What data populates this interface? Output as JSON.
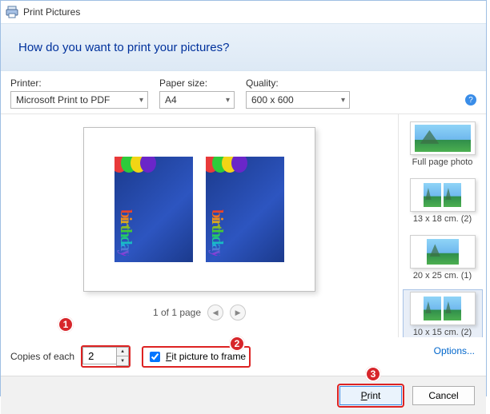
{
  "title": "Print Pictures",
  "header": {
    "question": "How do you want to print your pictures?"
  },
  "controls": {
    "printer_label": "Printer:",
    "printer_value": "Microsoft Print to PDF",
    "paper_label": "Paper size:",
    "paper_value": "A4",
    "quality_label": "Quality:",
    "quality_value": "600 x 600"
  },
  "preview": {
    "page_indicator": "1 of 1 page"
  },
  "layouts": [
    {
      "label": "Full page photo",
      "selected": false
    },
    {
      "label": "13 x 18 cm. (2)",
      "selected": false
    },
    {
      "label": "20 x 25 cm. (1)",
      "selected": false
    },
    {
      "label": "10 x 15 cm. (2)",
      "selected": true
    }
  ],
  "footer": {
    "copies_label": "Copies of each",
    "copies_value": "2",
    "fit_label_pre": "F",
    "fit_label_rest": "it picture to frame",
    "fit_checked": true,
    "options_link": "Options..."
  },
  "buttons": {
    "print": "Print",
    "cancel": "Cancel"
  },
  "callouts": {
    "one": "1",
    "two": "2",
    "three": "3"
  }
}
